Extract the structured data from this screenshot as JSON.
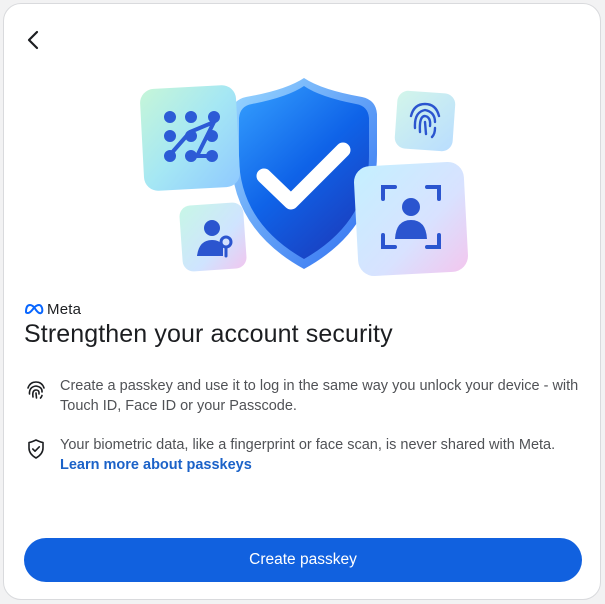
{
  "brand": {
    "name": "Meta"
  },
  "header": {
    "back_label": ""
  },
  "title": "Strengthen your account security",
  "items": [
    {
      "icon": "fingerprint-icon",
      "text": "Create a passkey and use it to log in the same way you unlock your device - with Touch ID, Face ID or your Passcode."
    },
    {
      "icon": "shield-check-icon",
      "text": "Your biometric data, like a fingerprint or face scan, is never shared with Meta. ",
      "link": "Learn more about passkeys"
    }
  ],
  "cta": {
    "label": "Create passkey"
  },
  "colors": {
    "primary": "#1161df",
    "link": "#1b62c8",
    "shield": "#0f63e8"
  }
}
